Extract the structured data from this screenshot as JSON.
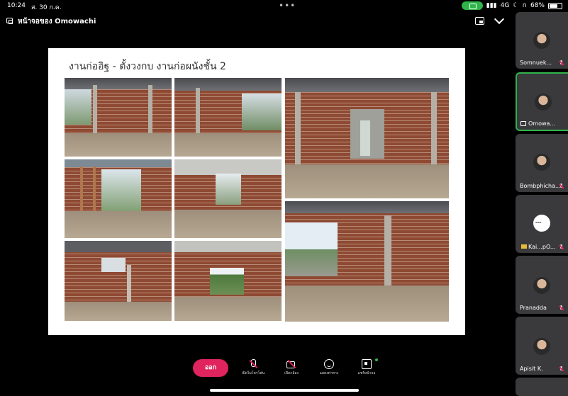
{
  "status": {
    "time": "10:24",
    "date": "ส. 30 ก.ค.",
    "network": "4G",
    "battery": "68%",
    "battery_level": 0.68
  },
  "meeting": {
    "title": "หน้าจอของ Omowachi"
  },
  "slide": {
    "title": "งานก่ออิฐ - ตั้งวงกบ  งานก่อผนังชั้น 2"
  },
  "participants": [
    {
      "name": "Somnuek..."
    },
    {
      "name": "Omowa..."
    },
    {
      "name": "Bombphicha..."
    },
    {
      "name": "Kai...pO..."
    },
    {
      "name": "Pranadda"
    },
    {
      "name": "Apisit K."
    }
  ],
  "controls": {
    "leave": "ออก",
    "mic": "เปิดไมโครโฟน",
    "camera": "เปิดกล้อง",
    "reactions": "แสดงท่าทาง",
    "share": "แชร์หน้าจอ"
  },
  "colors": {
    "accent_green": "#2fb44a",
    "leave_red": "#e0245e"
  },
  "icons": [
    "present-icon",
    "layout-icon",
    "chevron-down-icon",
    "mic-off-icon",
    "camera-off-icon",
    "emoji-icon",
    "share-screen-icon"
  ]
}
